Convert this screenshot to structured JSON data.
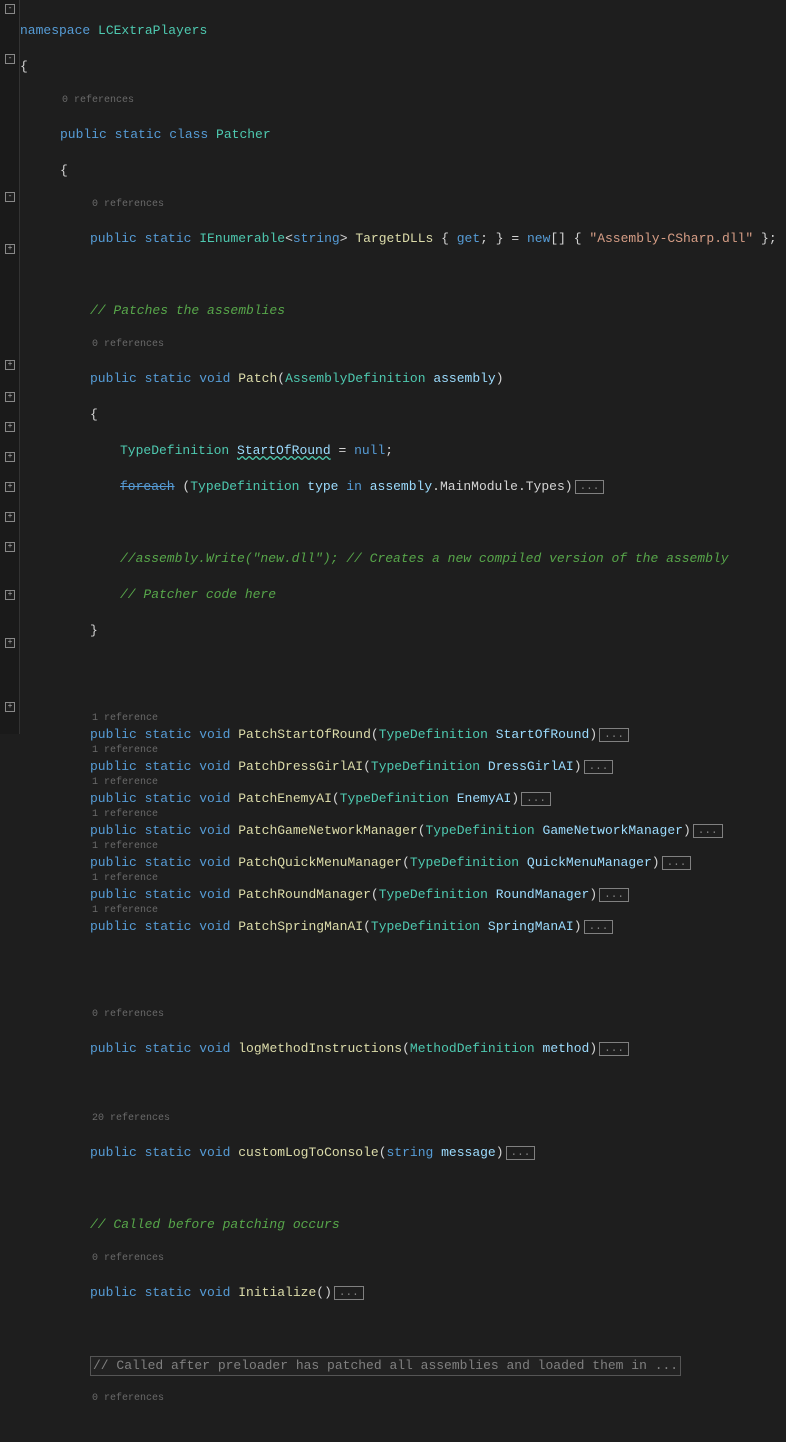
{
  "namespace": "LCExtraPlayers",
  "class_decl": {
    "modifiers": "public static class",
    "name": "Patcher"
  },
  "target_dlls": {
    "refs": "0 references",
    "modifiers": "public static",
    "type": "IEnumerable",
    "generic": "string",
    "name": "TargetDLLs",
    "accessor": "get",
    "init": "new",
    "value": "\"Assembly-CSharp.dll\""
  },
  "patch_comment": "// Patches the assemblies",
  "patch": {
    "refs": "0 references",
    "modifiers": "public static void",
    "name": "Patch",
    "ptype": "AssemblyDefinition",
    "pname": "assembly"
  },
  "body": {
    "td": "TypeDefinition",
    "sor": "StartOfRound",
    "null": "null",
    "foreach": "foreach",
    "type_kw": "type",
    "in": "in",
    "main": ".MainModule.Types",
    "c1": "//assembly.Write(\"new.dll\"); // Creates a new compiled version of the assembly",
    "c2": "// Patcher code here"
  },
  "methods": [
    {
      "refs": "1 reference",
      "name": "PatchStartOfRound",
      "ptype": "TypeDefinition",
      "pname": "StartOfRound"
    },
    {
      "refs": "1 reference",
      "name": "PatchDressGirlAI",
      "ptype": "TypeDefinition",
      "pname": "DressGirlAI"
    },
    {
      "refs": "1 reference",
      "name": "PatchEnemyAI",
      "ptype": "TypeDefinition",
      "pname": "EnemyAI"
    },
    {
      "refs": "1 reference",
      "name": "PatchGameNetworkManager",
      "ptype": "TypeDefinition",
      "pname": "GameNetworkManager"
    },
    {
      "refs": "1 reference",
      "name": "PatchQuickMenuManager",
      "ptype": "TypeDefinition",
      "pname": "QuickMenuManager"
    },
    {
      "refs": "1 reference",
      "name": "PatchRoundManager",
      "ptype": "TypeDefinition",
      "pname": "RoundManager"
    },
    {
      "refs": "1 reference",
      "name": "PatchSpringManAI",
      "ptype": "TypeDefinition",
      "pname": "SpringManAI"
    }
  ],
  "log_method": {
    "refs": "0 references",
    "name": "logMethodInstructions",
    "ptype": "MethodDefinition",
    "pname": "method"
  },
  "custom_log": {
    "refs": "20 references",
    "name": "customLogToConsole",
    "ptype": "string",
    "pname": "message"
  },
  "init_comment": "// Called before patching occurs",
  "init": {
    "refs": "0 references",
    "name": "Initialize"
  },
  "after_comment": "// Called after preloader has patched all assemblies and loaded them in ...",
  "trailing_refs": "0 references",
  "mods": "public static void",
  "fold_dots": "..."
}
